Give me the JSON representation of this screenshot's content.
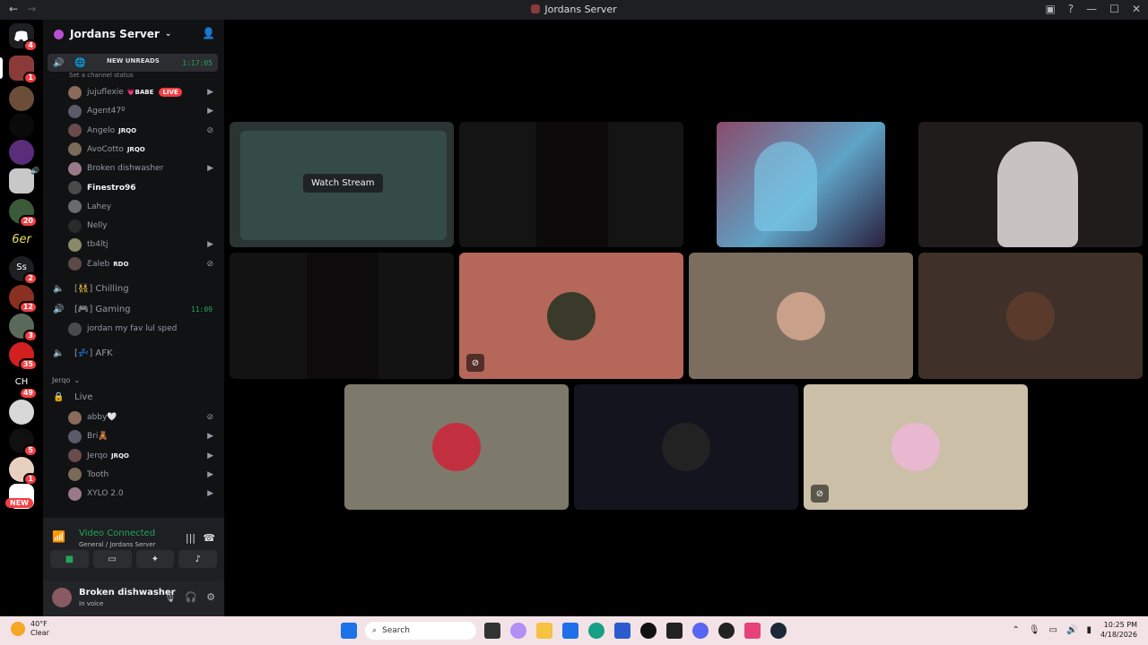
{
  "window": {
    "title": "Jordans Server",
    "nav_back": "←",
    "nav_fwd": "→"
  },
  "server": {
    "name": "Jordans Server"
  },
  "guild_badges": [
    "4",
    "1",
    "20",
    "2",
    "12",
    "3",
    "35",
    "49",
    "5",
    "1"
  ],
  "guild_new": "NEW",
  "guild_letters": {
    "ss": "Ss",
    "ch": "CH",
    "six": "6er"
  },
  "channels": {
    "general": {
      "name": "🌐",
      "timer": "1:17:05",
      "new_unreads": "NEW UNREADS",
      "status_placeholder": "Set a channel status"
    },
    "chilling": {
      "name": "[👯] Chilling"
    },
    "gaming": {
      "name": "[🎮] Gaming",
      "timer": "11:09",
      "member": "jordan my fav lul sped"
    },
    "afk": {
      "name": "[💤] AFK"
    },
    "category": "Jerqo",
    "live": {
      "name": "Live"
    }
  },
  "general_members": [
    {
      "name": "jujuflexie",
      "tag": "💗BABE",
      "live": "LIVE"
    },
    {
      "name": "Agent47º"
    },
    {
      "name": "Angelo",
      "tag": "JRQO"
    },
    {
      "name": "AvoCotto",
      "tag": "JRQO"
    },
    {
      "name": "Broken dishwasher"
    },
    {
      "name": "Finestro96"
    },
    {
      "name": "Lahey"
    },
    {
      "name": "Nelly"
    },
    {
      "name": "tb4ltj"
    },
    {
      "name": "Ƹaleb",
      "tag": "RDO"
    }
  ],
  "live_members": [
    {
      "name": "abby🤍"
    },
    {
      "name": "Bri🧸"
    },
    {
      "name": "Jerqo",
      "tag": "JRQO"
    },
    {
      "name": "Tooth"
    },
    {
      "name": "XYLO 2.0"
    }
  ],
  "voice_panel": {
    "status": "Video Connected",
    "location": "General / Jordans Server"
  },
  "user": {
    "name": "Broken dishwasher",
    "status": "In voice"
  },
  "stage": {
    "watch_label": "Watch Stream"
  },
  "taskbar": {
    "temp": "40°F",
    "cond": "Clear",
    "search": "Search",
    "time": "10:25 PM",
    "date": "4/18/2026"
  },
  "colors": {
    "accent_green": "#23a55a",
    "live_red": "#f23f43",
    "tile_orange": "#b5675a",
    "tile_taupe": "#7b6e5f",
    "tile_brown": "#3f3129",
    "tile_olive": "#7d7a6c",
    "tile_navy": "#14141f",
    "tile_cream": "#cbbfa7"
  }
}
